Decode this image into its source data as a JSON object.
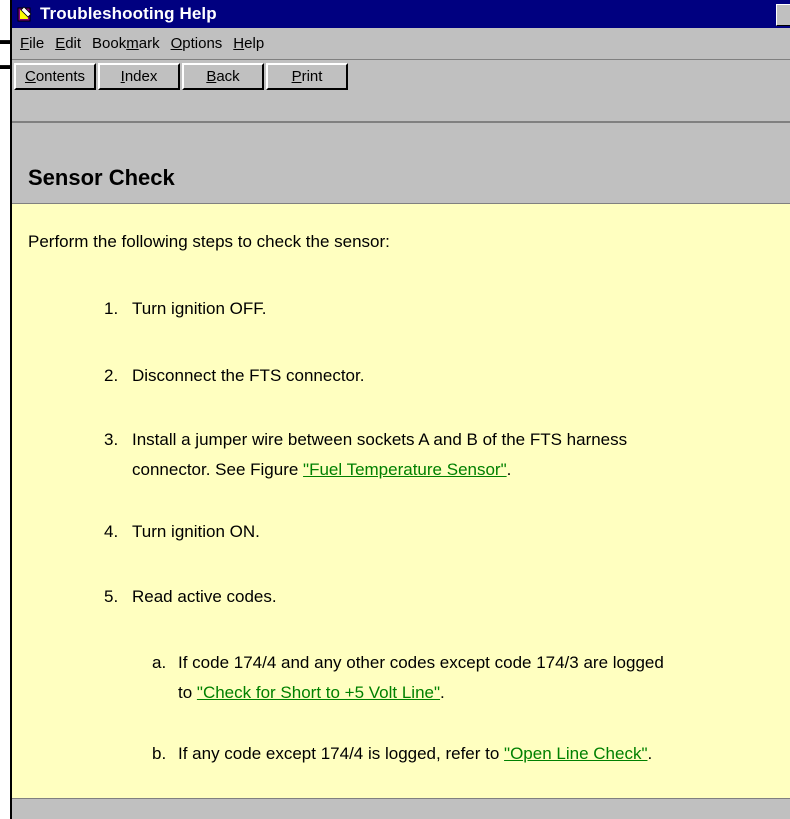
{
  "window": {
    "title": "Troubleshooting Help"
  },
  "menu": {
    "items": [
      {
        "label": "File",
        "mnemonic": "F",
        "rest": "ile"
      },
      {
        "label": "Edit",
        "mnemonic": "E",
        "rest": "dit"
      },
      {
        "label": "Bookmark",
        "pre": "Book",
        "mnemonic": "m",
        "rest": "ark"
      },
      {
        "label": "Options",
        "mnemonic": "O",
        "rest": "ptions"
      },
      {
        "label": "Help",
        "mnemonic": "H",
        "rest": "elp"
      }
    ]
  },
  "buttons": {
    "contents": {
      "mnemonic": "C",
      "rest": "ontents"
    },
    "index": {
      "mnemonic": "I",
      "rest": "ndex"
    },
    "back": {
      "mnemonic": "B",
      "rest": "ack"
    },
    "print": {
      "mnemonic": "P",
      "rest": "rint"
    }
  },
  "topic": {
    "title": "Sensor Check",
    "intro": "Perform the following steps to check the sensor:",
    "steps": [
      {
        "num": "1.",
        "text": "Turn ignition OFF."
      },
      {
        "num": "2.",
        "text": "Disconnect the FTS connector."
      },
      {
        "num": "3.",
        "line1": "Install a jumper wire between sockets A and B of the FTS harness",
        "line2_pre": "connector. See Figure ",
        "link": "\"Fuel Temperature Sensor\"",
        "line2_post": "."
      },
      {
        "num": "4.",
        "text": "Turn ignition ON."
      },
      {
        "num": "5.",
        "text": "Read active codes."
      }
    ],
    "substeps": [
      {
        "letter": "a.",
        "line1": "If code 174/4 and any other codes except code 174/3 are logged",
        "line2_pre": "to ",
        "link": "\"Check for Short to +5 Volt Line\"",
        "line2_post": "."
      },
      {
        "letter": "b.",
        "pre": "If any code except 174/4 is logged, refer to ",
        "link": "\"Open Line Check\"",
        "post": "."
      }
    ]
  },
  "colors": {
    "titlebar": "#000080",
    "content_bg": "#ffffc0",
    "link": "#008000",
    "chrome": "#c0c0c0"
  }
}
